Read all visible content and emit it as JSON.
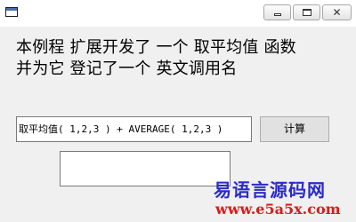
{
  "window": {
    "title_icon": "window-icon",
    "controls": {
      "minimize": "minimize-icon",
      "maximize": "maximize-icon",
      "close_label": "✕"
    }
  },
  "description": {
    "line1": "本例程 扩展开发了 一个 取平均值 函数",
    "line2": "并为它 登记了一个 英文调用名"
  },
  "form": {
    "expression_value": "取平均值( 1,2,3 ) + AVERAGE( 1,2,3 )",
    "calc_button_label": "计算",
    "result_value": ""
  },
  "watermark": {
    "title": "易语言源码网",
    "url": "www.e5a5x.com",
    "title_color": "#2b2bc8",
    "url_color": "#d81c1c"
  }
}
